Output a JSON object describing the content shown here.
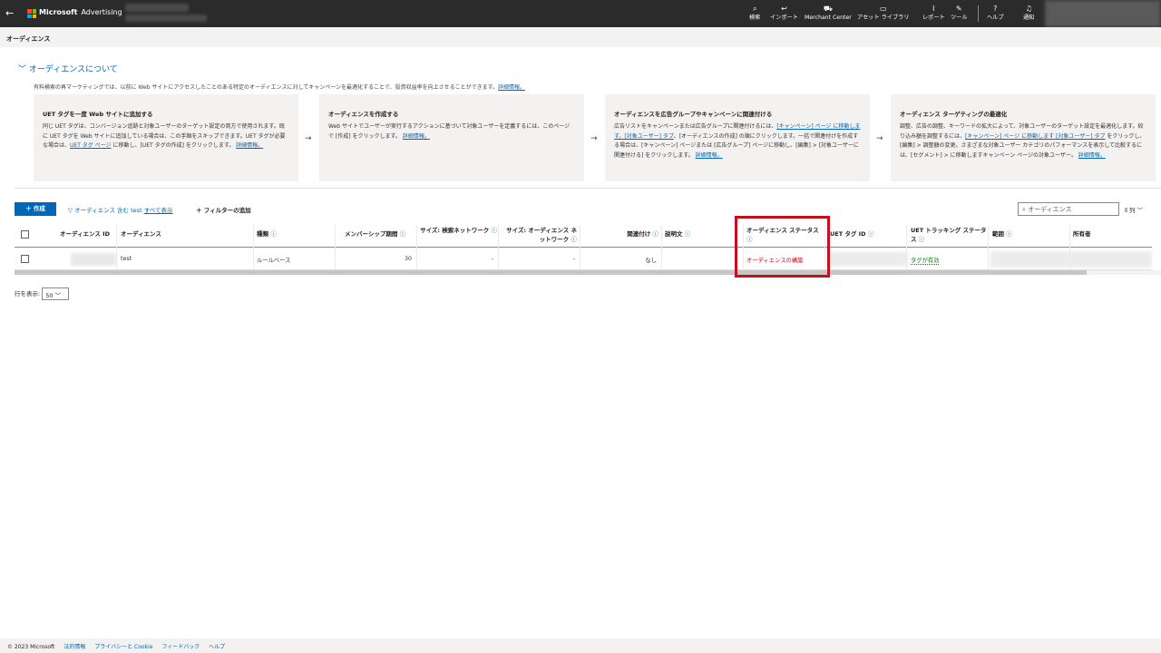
{
  "topbar": {
    "brand": "Microsoft",
    "brand_sub": "Advertising",
    "nav": [
      {
        "label": "検索",
        "icon": "search-icon",
        "glyph": "⌕"
      },
      {
        "label": "インポート",
        "icon": "import-icon",
        "glyph": "↩"
      },
      {
        "label": "Merchant Center",
        "icon": "cart-icon",
        "glyph": "⛟"
      },
      {
        "label": "アセット ライブラリ",
        "icon": "library-icon",
        "glyph": "▭"
      },
      {
        "label": "レポート",
        "icon": "chart-icon",
        "glyph": "⌇"
      },
      {
        "label": "ツール",
        "icon": "wrench-icon",
        "glyph": "✎"
      },
      {
        "label": "ヘルプ",
        "icon": "help-icon",
        "glyph": "?"
      },
      {
        "label": "通知",
        "icon": "bell-icon",
        "glyph": "♫"
      }
    ]
  },
  "breadcrumb": "オーディエンス",
  "about": {
    "title": "オーディエンスについて",
    "desc": "有料検索の再マーケティングでは、以前に Web サイトにアクセスしたことのある特定のオーディエンスに対してキャンペーンを最適化することで、投資収益率を向上させることができます。",
    "desc_link": "詳細情報。",
    "cards": [
      {
        "title": "UET タグを一度 Web サイトに追加する",
        "body": "同じ UET タグは、コンバージョン追跡と対象ユーザーのターゲット設定の両方で使用されます。既に UET タグを Web サイトに追加している場合は、この手順をスキップできます。UET タグが必要な場合は、",
        "link1": "UET タグ ページ",
        "body2": " に移動し、[UET タグの作成] をクリックします。",
        "link2": "詳細情報。"
      },
      {
        "title": "オーディエンスを作成する",
        "body": "Web サイトでユーザーが実行するアクションに基づいて対象ユーザーを定義するには、このページで [作成] をクリックします。",
        "link1": "詳細情報。",
        "body2": "",
        "link2": ""
      },
      {
        "title": "オーディエンスを広告グループやキャンペーンに関連付ける",
        "body": "広告リストをキャンペーンまたは広告グループに関連付けるには、",
        "link1": "[キャンペーン] ページ に移動します。[対象ユーザー] タブ",
        "body2": "、[オーディエンスの作成] の順にクリックします。一括で関連付けを作成する場合は、[キャンペーン] ページまたは [広告グループ] ページに移動し、[編集] > [対象ユーザーに関連付ける] をクリックします。",
        "link2": "詳細情報。"
      },
      {
        "title": "オーディエンス ターゲティングの最適化",
        "body": "調整、広告の調整、キーワードの拡大によって、対象ユーザーのターゲット設定を最適化します。絞り込み額を調整するには、",
        "link1": "[キャンペーン] ページ に移動します [対象ユーザー] タブ",
        "body2": " をクリックし、[編集] > 調整額の変更。さまざまな対象ユーザー カテゴリのパフォーマンスを表示して比較するには、[セグメント] > に移動しますキャンペーン ページの対象ユーザー。",
        "link2": "詳細情報。"
      }
    ]
  },
  "toolbar": {
    "create": "＋ 作成",
    "filter": "オーディエンス 含む test",
    "show_all": "すべて表示",
    "add_filter": "＋ フィルターの追加",
    "search_placeholder": "オーディエンス",
    "columns": "列"
  },
  "table": {
    "headers": [
      {
        "key": "id",
        "label": "オーディエンス ID",
        "help": false
      },
      {
        "key": "name",
        "label": "オーディエンス",
        "help": false
      },
      {
        "key": "type",
        "label": "種類",
        "help": true
      },
      {
        "key": "duration",
        "label": "メンバーシップ期間",
        "help": true
      },
      {
        "key": "size_search",
        "label": "サイズ: 検索ネットワーク",
        "help": true
      },
      {
        "key": "size_audience",
        "label": "サイズ: オーディエンス ネットワーク",
        "help": true
      },
      {
        "key": "assoc",
        "label": "関連付け",
        "help": true
      },
      {
        "key": "desc",
        "label": "説明文",
        "help": true
      },
      {
        "key": "status",
        "label": "オーディエンス ステータス",
        "help": true
      },
      {
        "key": "uet",
        "label": "UET タグ ID",
        "help": true
      },
      {
        "key": "uet_status",
        "label": "UET トラッキング ステータス",
        "help": true
      },
      {
        "key": "scope",
        "label": "範囲",
        "help": true
      },
      {
        "key": "owner",
        "label": "所有者",
        "help": false
      }
    ],
    "row": {
      "name": "test",
      "type": "ルールベース",
      "duration": "30",
      "size_search": "-",
      "size_audience": "-",
      "assoc": "なし",
      "status": "オーディエンスの構築",
      "uet_status": "タグが有効"
    }
  },
  "pager": {
    "label": "行を表示:",
    "value": "50"
  },
  "footer": {
    "copyright": "© 2023 Microsoft",
    "links": [
      "法的情報",
      "プライバシーと Cookie",
      "フィードバック",
      "ヘルプ"
    ]
  },
  "colors": {
    "accent": "#0067b8",
    "topbar": "#2b2b2b",
    "highlight": "#c50f1f",
    "status_red": "#c50f1f",
    "status_green": "#107c10"
  }
}
